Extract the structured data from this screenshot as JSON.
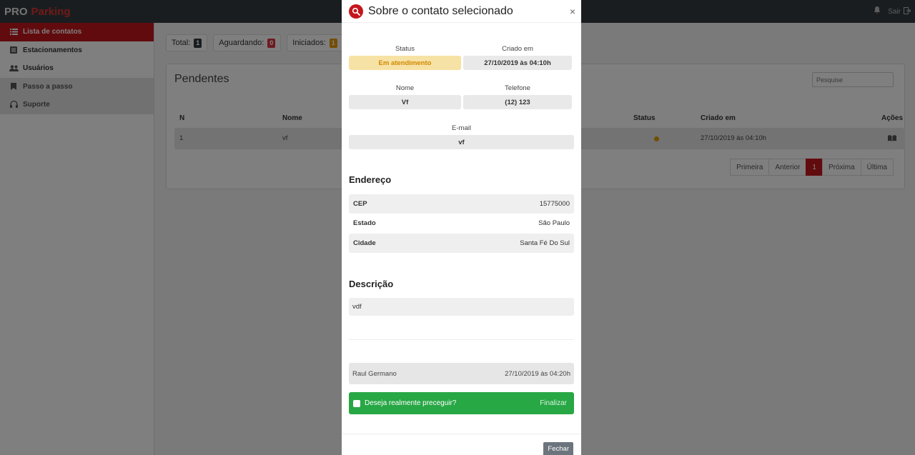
{
  "brand": {
    "part1": "PRO",
    "part2": "Parking"
  },
  "topbar": {
    "exit_label": "Sair"
  },
  "sidebar": {
    "items": [
      {
        "label": "Lista de contatos",
        "icon": "list-icon"
      },
      {
        "label": "Estacionamentos",
        "icon": "document-icon"
      },
      {
        "label": "Usuários",
        "icon": "users-icon"
      },
      {
        "label": "Passo a passo",
        "icon": "bookmark-icon"
      },
      {
        "label": "Suporte",
        "icon": "headset-icon"
      }
    ]
  },
  "counters": {
    "total_label": "Total:",
    "total_value": "1",
    "waiting_label": "Aguardando:",
    "waiting_value": "0",
    "started_label": "Iniciados:",
    "started_value": "1"
  },
  "card": {
    "title": "Pendentes",
    "search_placeholder": "Pesquise",
    "columns": {
      "n": "N",
      "name": "Nome",
      "status": "Status",
      "created": "Criado em",
      "actions": "Ações"
    },
    "rows": [
      {
        "n": "1",
        "name": "vf",
        "created": "27/10/2019 às 04:10h"
      }
    ],
    "pagination": [
      "Primeira",
      "Anterior",
      "1",
      "Próxima",
      "Última"
    ]
  },
  "modal": {
    "title": "Sobre o contato selecionado",
    "close_glyph": "×",
    "status_label": "Status",
    "status_value": "Em atendimento",
    "created_label": "Criado em",
    "created_value": "27/10/2019 às 04:10h",
    "name_label": "Nome",
    "name_value": "Vf",
    "phone_label": "Telefone",
    "phone_value": "(12) 123",
    "email_label": "E-mail",
    "email_value": "vf",
    "address_heading": "Endereço",
    "cep_label": "CEP",
    "cep_value": "15775000",
    "state_label": "Estado",
    "state_value": "São Paulo",
    "city_label": "Cidade",
    "city_value": "Santa Fé Do Sul",
    "description_heading": "Descrição",
    "description_value": "vdf",
    "log_user": "Raul Germano",
    "log_date": "27/10/2019 às 04:20h",
    "confirm_question": "Deseja realmente preceguir?",
    "confirm_action": "Finalizar",
    "close_button": "Fechar"
  },
  "colors": {
    "brand_red": "#c4161c",
    "success": "#28a745",
    "warning_bg": "#f7e2a5",
    "warning_text": "#d08800"
  }
}
